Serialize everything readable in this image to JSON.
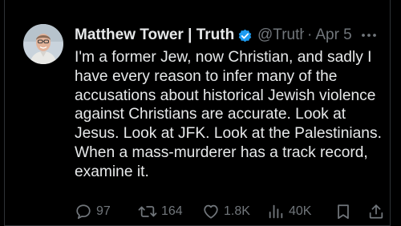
{
  "post": {
    "author_name": "Matthew Tower | Truth",
    "handle": "@Truth",
    "separator": "·",
    "date": "Apr 5",
    "text": "I'm a former Jew, now Christian, and sadly I\nhave every reason to infer many of the\naccusations about historical Jewish violence\nagainst Christians are accurate. Look at\nJesus. Look at JFK. Look at the Palestinians.\nWhen a mass-murderer has a track record,\nexamine it."
  },
  "actions": {
    "replies": "97",
    "reposts": "164",
    "likes": "1.8K",
    "views": "40K"
  },
  "icons": {
    "verified": "verified-badge-icon",
    "more": "more-options-icon",
    "reply": "reply-icon",
    "repost": "repost-icon",
    "like": "heart-icon",
    "views": "analytics-icon",
    "bookmark": "bookmark-icon",
    "share": "share-icon"
  },
  "colors": {
    "background": "#000000",
    "primary_text": "#e7e9ea",
    "secondary_text": "#71767b",
    "verified_blue": "#1d9bf0"
  }
}
